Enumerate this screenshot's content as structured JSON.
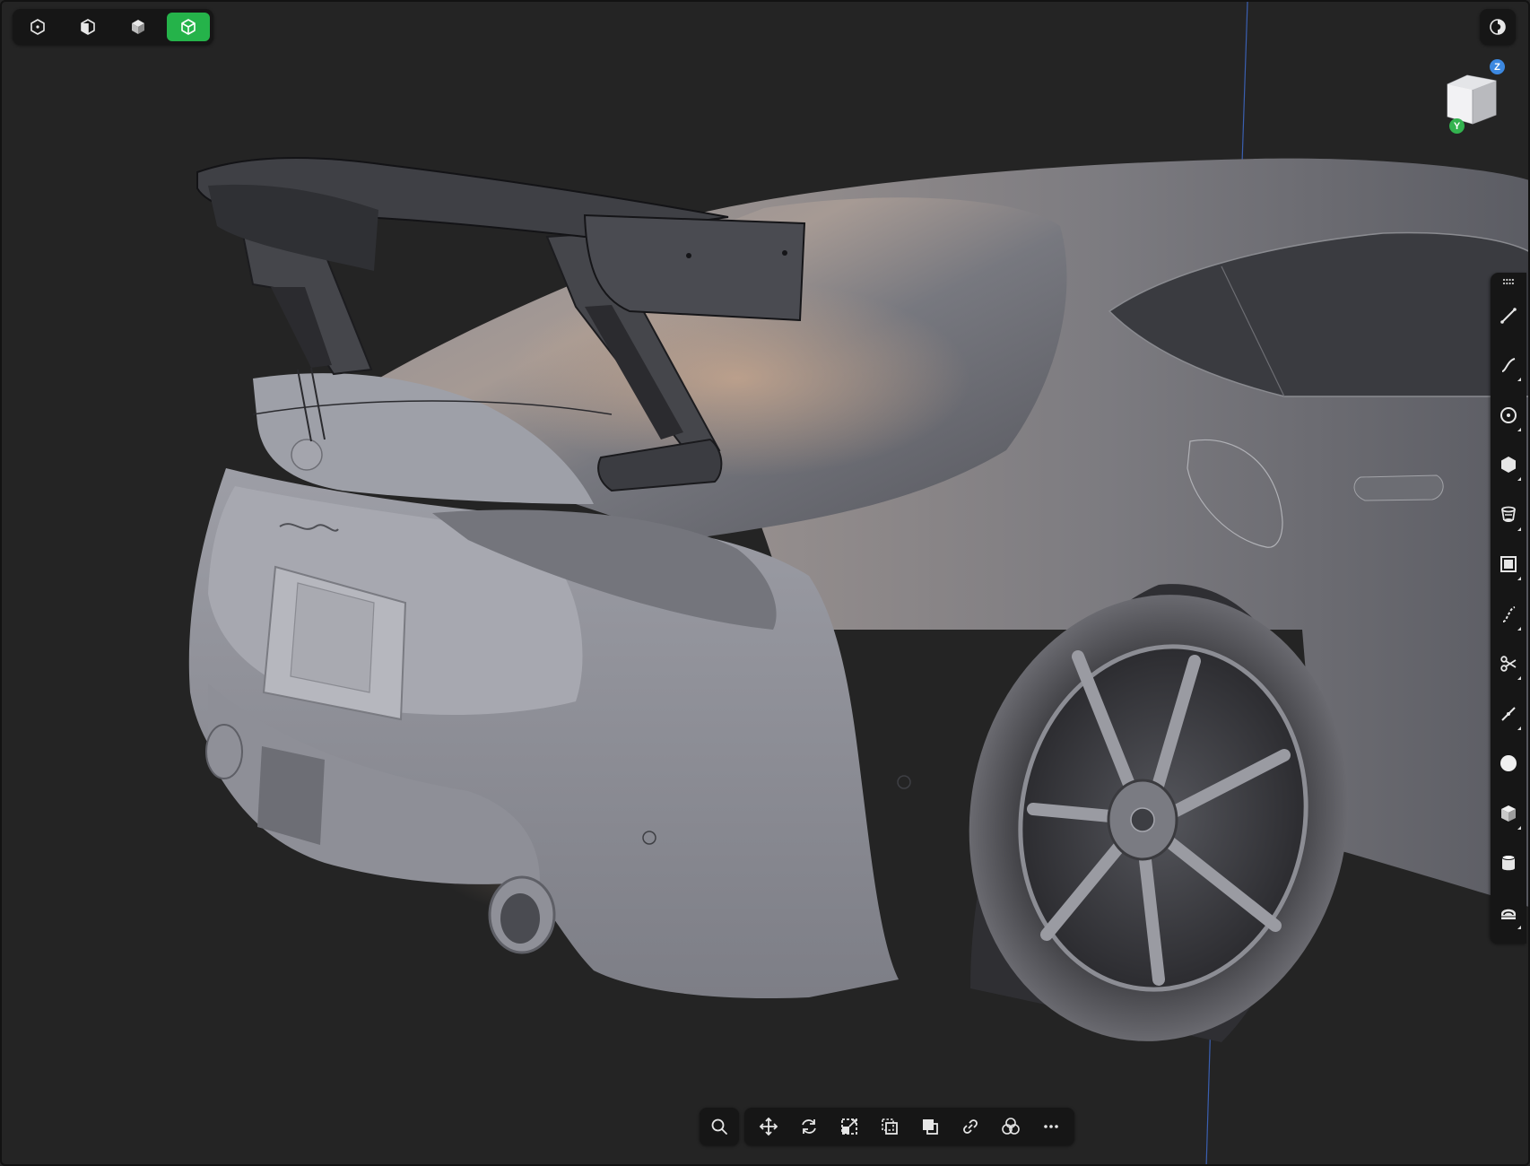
{
  "app": {
    "accent_color": "#25b34a",
    "background_color": "#242424"
  },
  "display_modes": [
    {
      "icon": "wireframe-cube-dot-icon",
      "active": false
    },
    {
      "icon": "half-shaded-cube-icon",
      "active": false
    },
    {
      "icon": "solid-cube-icon",
      "active": false
    },
    {
      "icon": "shaded-cube-icon",
      "active": true
    }
  ],
  "theme_toggle": {
    "icon": "contrast-icon"
  },
  "view_cube": {
    "axis_z_label": "Z",
    "axis_y_label": "Y",
    "axis_z_color": "#3c88e0",
    "axis_y_color": "#33b34f"
  },
  "tool_rail": {
    "tools": [
      {
        "icon": "line-tool-icon",
        "has_submenu": false
      },
      {
        "icon": "curve-tool-icon",
        "has_submenu": true
      },
      {
        "icon": "circle-tool-icon",
        "has_submenu": true
      },
      {
        "icon": "polygon-tool-icon",
        "has_submenu": true
      },
      {
        "icon": "loft-tool-icon",
        "has_submenu": true
      },
      {
        "icon": "offset-surface-icon",
        "has_submenu": true
      },
      {
        "icon": "blend-curve-icon",
        "has_submenu": true
      },
      {
        "icon": "trim-scissors-icon",
        "has_submenu": true
      },
      {
        "icon": "fillet-curve-icon",
        "has_submenu": true
      },
      {
        "icon": "sphere-icon",
        "has_submenu": false
      },
      {
        "icon": "box-solid-icon",
        "has_submenu": true
      },
      {
        "icon": "cylinder-icon",
        "has_submenu": false
      },
      {
        "icon": "shell-tool-icon",
        "has_submenu": true
      }
    ]
  },
  "bottom_toolbar": {
    "search": {
      "icon": "search-icon"
    },
    "tools": [
      {
        "icon": "move-icon"
      },
      {
        "icon": "rotate-icon"
      },
      {
        "icon": "scale-icon"
      },
      {
        "icon": "copy-transform-icon"
      },
      {
        "icon": "boolean-icon"
      },
      {
        "icon": "link-icon"
      },
      {
        "icon": "combine-icon"
      },
      {
        "icon": "more-icon"
      }
    ]
  }
}
